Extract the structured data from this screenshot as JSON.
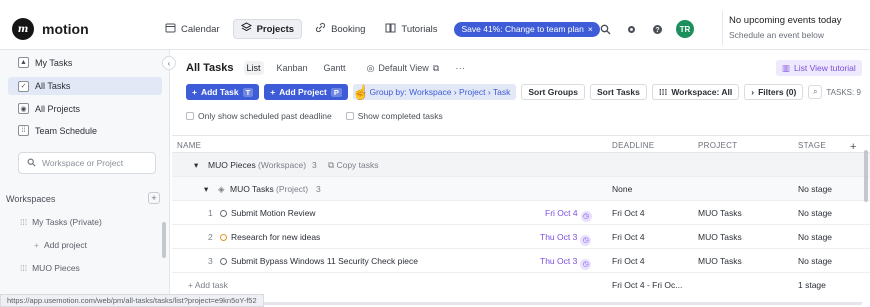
{
  "app": {
    "name": "motion",
    "logo_glyph": "m"
  },
  "topnav": [
    {
      "label": "Calendar",
      "icon": "calendar-icon"
    },
    {
      "label": "Projects",
      "icon": "projects-icon",
      "active": true
    },
    {
      "label": "Booking",
      "icon": "link-icon"
    },
    {
      "label": "Tutorials",
      "icon": "book-icon"
    }
  ],
  "promo": {
    "label": "Save 41%: Change to team plan",
    "close": "×"
  },
  "avatar": {
    "initials": "TR",
    "color": "#1d8f5c"
  },
  "events": {
    "title": "No upcoming events today",
    "subtitle": "Schedule an event below"
  },
  "sidebar": {
    "items": [
      {
        "label": "My Tasks",
        "icon": "user-icon"
      },
      {
        "label": "All Tasks",
        "icon": "check-icon",
        "selected": true
      },
      {
        "label": "All Projects",
        "icon": "projects-icon"
      },
      {
        "label": "Team Schedule",
        "icon": "team-icon"
      }
    ],
    "search_placeholder": "Workspace or Project",
    "section_title": "Workspaces",
    "workspaces": [
      {
        "label": "My Tasks (Private)"
      },
      {
        "label": "Add project"
      },
      {
        "label": "MUO Pieces"
      }
    ]
  },
  "view": {
    "title": "All Tasks",
    "tabs": [
      "List",
      "Kanban",
      "Gantt"
    ],
    "active_tab": "List",
    "default_view": "Default View",
    "more": "···",
    "tutorial": "List View tutorial"
  },
  "actions": {
    "add_task": "Add Task",
    "add_task_key": "T",
    "add_project": "Add Project",
    "add_project_key": "P",
    "group_by": "Group by: Workspace › Project › Task",
    "sort_groups": "Sort Groups",
    "sort_tasks": "Sort Tasks",
    "workspace": "Workspace: All",
    "filters": "Filters (0)",
    "tasks_count": "TASKS: 9"
  },
  "checks": {
    "past_deadline": "Only show scheduled past deadline",
    "completed": "Show completed tasks"
  },
  "table": {
    "headers": {
      "name": "NAME",
      "deadline": "DEADLINE",
      "project": "PROJECT",
      "stage": "STAGE"
    },
    "group": {
      "name": "MUO Pieces",
      "type": "(Workspace)",
      "count": "3",
      "copy": "Copy tasks"
    },
    "subgroup": {
      "name": "MUO Tasks",
      "type": "(Project)",
      "count": "3",
      "deadline": "None",
      "stage": "No stage"
    },
    "rows": [
      {
        "num": "1",
        "name": "Submit Motion Review",
        "due": "Fri Oct 4",
        "deadline": "Fri Oct 4",
        "project": "MUO Tasks",
        "stage": "No stage",
        "circle": "grey"
      },
      {
        "num": "2",
        "name": "Research for new ideas",
        "due": "Thu Oct 3",
        "deadline": "Fri Oct 4",
        "project": "MUO Tasks",
        "stage": "No stage",
        "circle": "orange"
      },
      {
        "num": "3",
        "name": "Submit Bypass Windows 11 Security Check piece",
        "due": "Thu Oct 3",
        "deadline": "Fri Oct 4",
        "project": "MUO Tasks",
        "stage": "No stage",
        "circle": "grey"
      }
    ],
    "footer": {
      "add": "+ Add task",
      "deadline": "Fri Oct 4 - Fri Oc...",
      "stage": "1 stage"
    }
  },
  "statusbar": "https://app.usemotion.com/web/pm/all-tasks/tasks/list?project=e9kn5oY-f52",
  "colors": {
    "accent": "#3e5cd8",
    "purple": "#7a4fe0"
  }
}
